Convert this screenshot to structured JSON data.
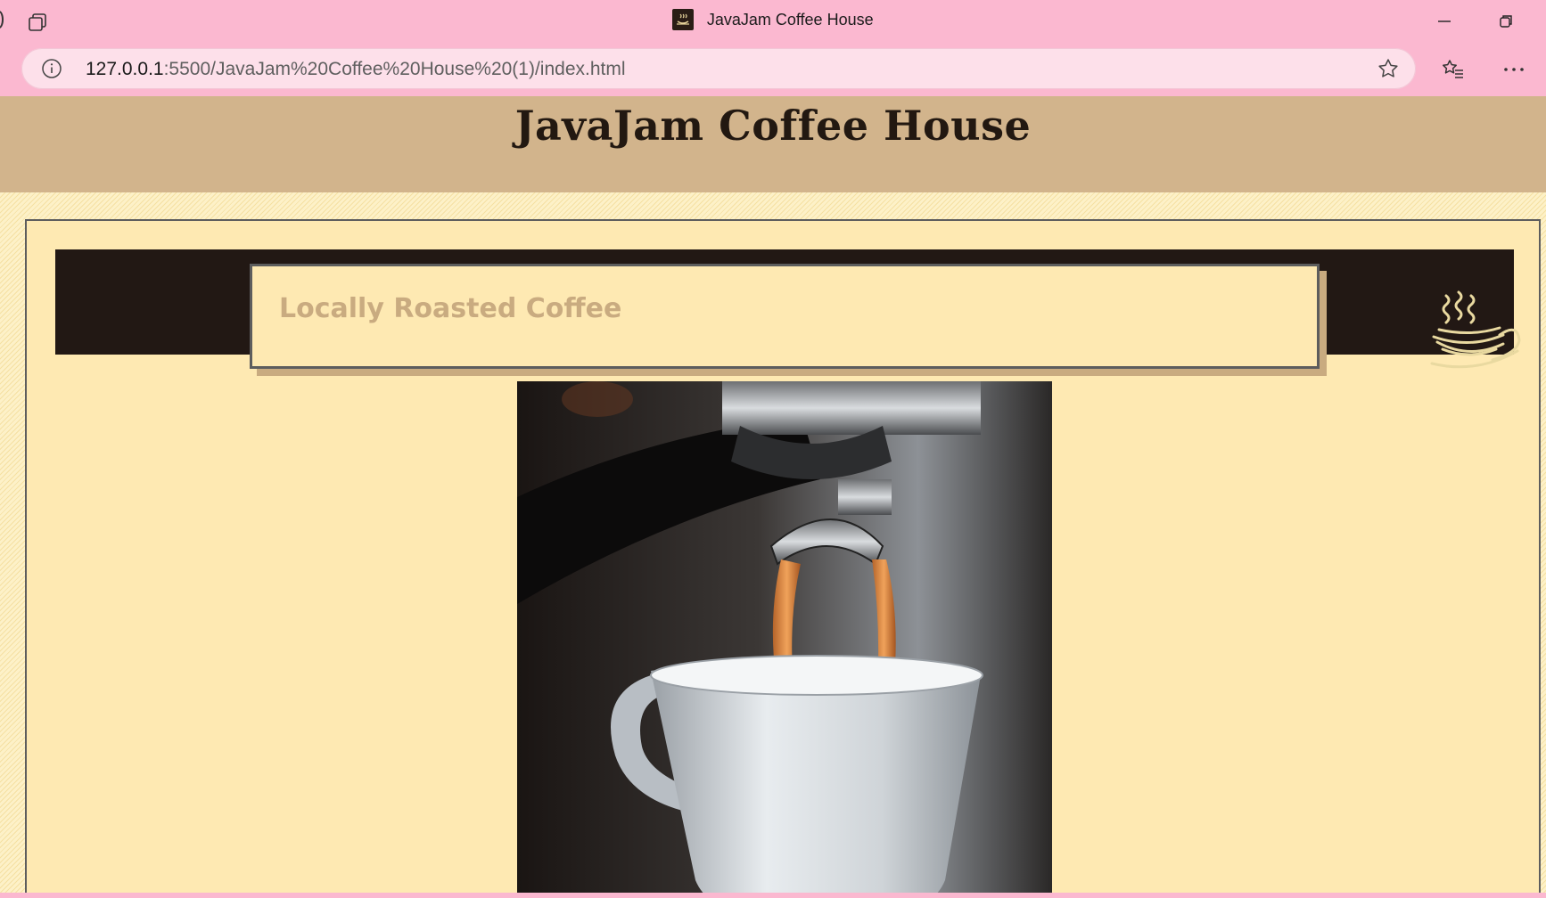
{
  "browser": {
    "tab_title": "JavaJam Coffee House",
    "url_host": "127.0.0.1",
    "url_rest": ":5500/JavaJam%20Coffee%20House%20(1)/index.html",
    "chrome_color": "#fbb8d0"
  },
  "page": {
    "site_title": "JavaJam Coffee House",
    "hero_heading": "Locally Roasted Coffee",
    "colors": {
      "header_bg": "#d2b48c",
      "wrapper_bg": "#fee9b2",
      "band_dark": "#221814",
      "heading_tan": "#c9ab80"
    }
  }
}
